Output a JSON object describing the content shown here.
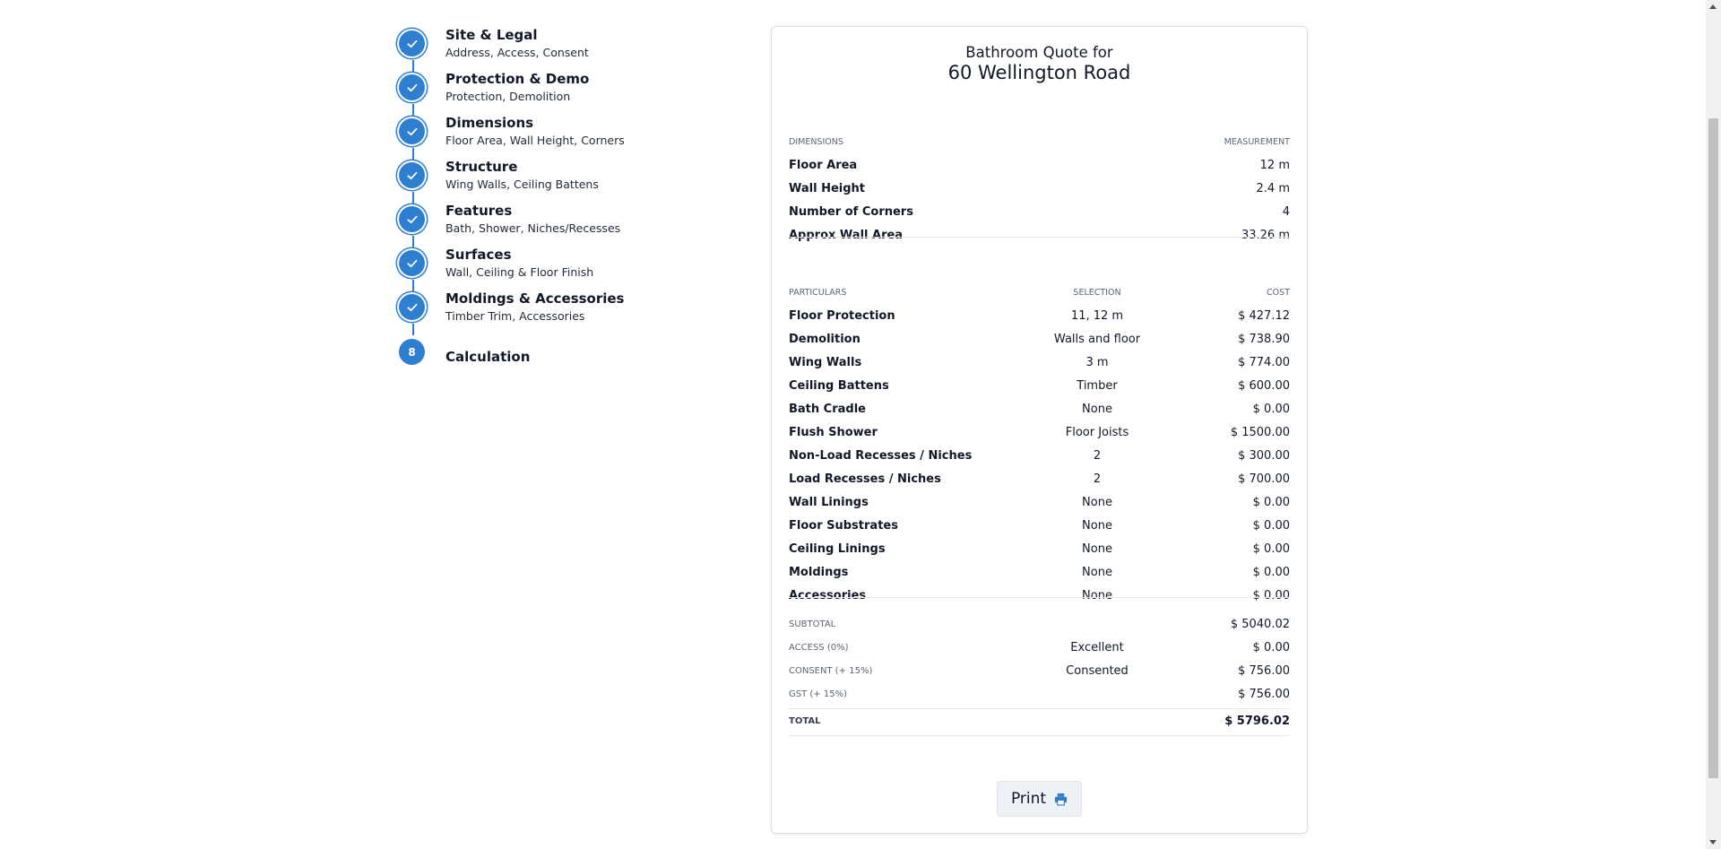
{
  "steps": [
    {
      "title": "Site & Legal",
      "sub": "Address, Access, Consent",
      "done": true
    },
    {
      "title": "Protection & Demo",
      "sub": "Protection, Demolition",
      "done": true
    },
    {
      "title": "Dimensions",
      "sub": "Floor Area, Wall Height, Corners",
      "done": true
    },
    {
      "title": "Structure",
      "sub": "Wing Walls, Ceiling Battens",
      "done": true
    },
    {
      "title": "Features",
      "sub": "Bath, Shower, Niches/Recesses",
      "done": true
    },
    {
      "title": "Surfaces",
      "sub": "Wall, Ceiling & Floor Finish",
      "done": true
    },
    {
      "title": "Moldings & Accessories",
      "sub": "Timber Trim, Accessories",
      "done": true
    },
    {
      "title": "Calculation",
      "number": "8",
      "done": false
    }
  ],
  "quote": {
    "heading1": "Bathroom Quote for",
    "heading2": "60 Wellington Road",
    "dimensions_header": {
      "label": "DIMENSIONS",
      "value": "MEASUREMENT"
    },
    "dimensions": [
      {
        "label": "Floor Area",
        "value": "12 m"
      },
      {
        "label": "Wall Height",
        "value": "2.4 m"
      },
      {
        "label": "Number of Corners",
        "value": "4"
      },
      {
        "label": "Approx Wall Area",
        "value": "33.26 m"
      }
    ],
    "particulars_header": {
      "label": "PARTICULARS",
      "selection": "SELECTION",
      "cost": "COST"
    },
    "particulars": [
      {
        "label": "Floor Protection",
        "selection": "11, 12 m",
        "cost": "$ 427.12"
      },
      {
        "label": "Demolition",
        "selection": "Walls and floor",
        "cost": "$ 738.90"
      },
      {
        "label": "Wing Walls",
        "selection": "3 m",
        "cost": "$ 774.00"
      },
      {
        "label": "Ceiling Battens",
        "selection": "Timber",
        "cost": "$ 600.00"
      },
      {
        "label": "Bath Cradle",
        "selection": "None",
        "cost": "$ 0.00"
      },
      {
        "label": "Flush Shower",
        "selection": "Floor Joists",
        "cost": "$ 1500.00"
      },
      {
        "label": "Non-Load Recesses / Niches",
        "selection": "2",
        "cost": "$ 300.00"
      },
      {
        "label": "Load Recesses / Niches",
        "selection": "2",
        "cost": "$ 700.00"
      },
      {
        "label": "Wall Linings",
        "selection": "None",
        "cost": "$ 0.00"
      },
      {
        "label": "Floor Substrates",
        "selection": "None",
        "cost": "$ 0.00"
      },
      {
        "label": "Ceiling Linings",
        "selection": "None",
        "cost": "$ 0.00"
      },
      {
        "label": "Moldings",
        "selection": "None",
        "cost": "$ 0.00"
      },
      {
        "label": "Accessories",
        "selection": "None",
        "cost": "$ 0.00"
      }
    ],
    "summary": [
      {
        "label": "SUBTOTAL",
        "selection": "",
        "cost": "$ 5040.02"
      },
      {
        "label": "ACCESS (0%)",
        "selection": "Excellent",
        "cost": "$ 0.00"
      },
      {
        "label": "CONSENT (+ 15%)",
        "selection": "Consented",
        "cost": "$ 756.00"
      },
      {
        "label": "GST (+ 15%)",
        "selection": "",
        "cost": "$ 756.00"
      }
    ],
    "total": {
      "label": "TOTAL",
      "cost": "$ 5796.02"
    },
    "print_label": "Print"
  },
  "colors": {
    "accent": "#2f7fd1"
  }
}
